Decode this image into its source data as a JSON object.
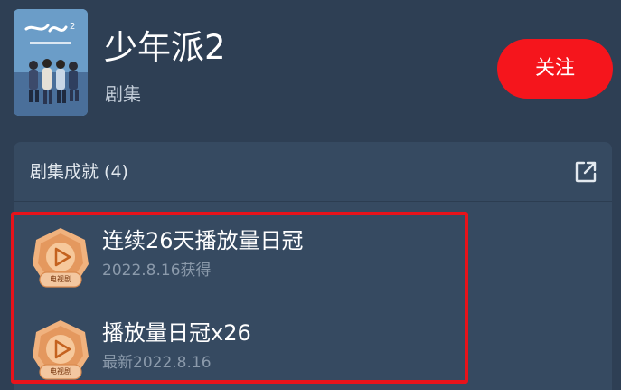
{
  "show": {
    "title": "少年派2",
    "type_label": "剧集",
    "follow_label": "关注"
  },
  "achievements": {
    "header": "剧集成就 (4)",
    "items": [
      {
        "title": "连续26天播放量日冠",
        "date": "2022.8.16获得",
        "badge_label": "电视剧"
      },
      {
        "title": "播放量日冠x26",
        "date": "最新2022.8.16",
        "badge_label": "电视剧"
      }
    ]
  },
  "colors": {
    "background": "#2e3f54",
    "card": "#364a61",
    "accent_red": "#f5151c",
    "highlight_border": "#e8131b",
    "badge_orange": "#e9a56f"
  },
  "icons": [
    "show-poster",
    "share-icon",
    "play-badge-icon"
  ]
}
